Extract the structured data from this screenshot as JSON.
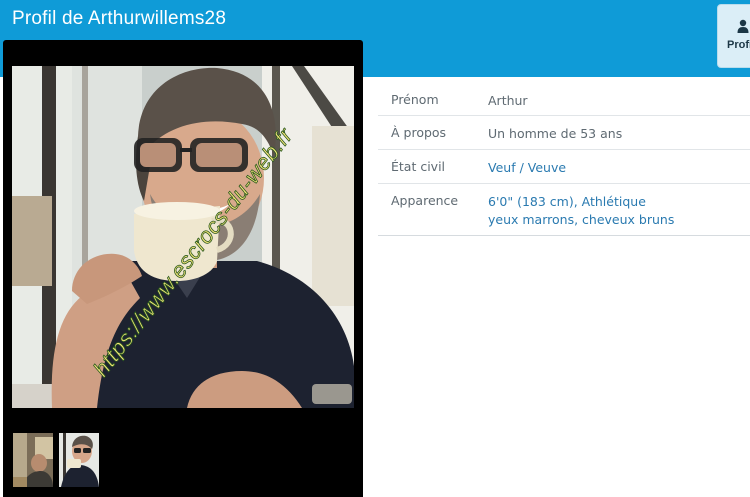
{
  "header": {
    "title": "Profil de Arthurwillems28",
    "profile_tab_label": "Profil",
    "profile_tab_icon": "user-icon",
    "background_color": "#0f9bd7"
  },
  "photo": {
    "watermark": "https://www.escrocs-du-web.fr",
    "thumbnails": [
      "photo-1",
      "photo-2"
    ]
  },
  "details": {
    "rows": [
      {
        "label": "Prénom",
        "value": "Arthur"
      },
      {
        "label": "À propos",
        "value": "Un homme de 53 ans"
      },
      {
        "label": "État civil",
        "value": "Veuf / Veuve"
      },
      {
        "label": "Apparence",
        "value_line1": "6'0\" (183 cm), Athlétique",
        "value_line2": "yeux marrons, cheveux bruns"
      }
    ],
    "link_color": "#2a7ab0",
    "label_color": "#5f6a72"
  }
}
